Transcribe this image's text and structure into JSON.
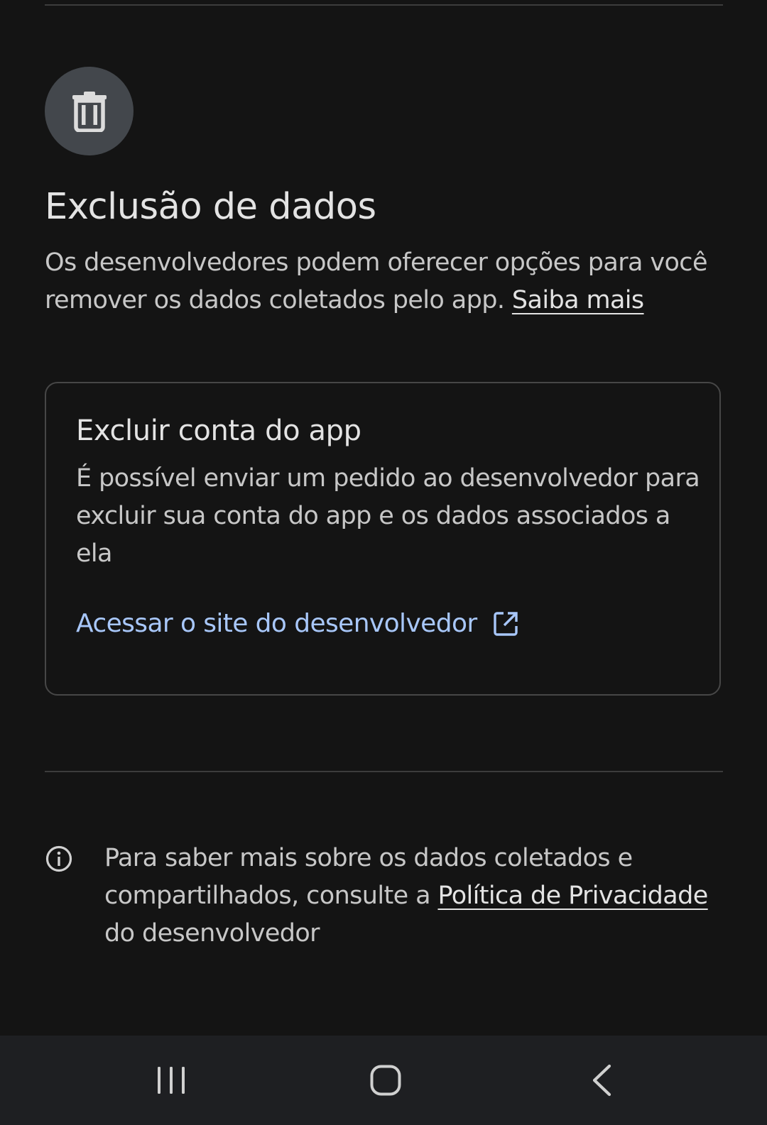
{
  "deletion_section": {
    "title": "Exclusão de dados",
    "description": "Os desenvolvedores podem oferecer opções para você remover os dados coletados pelo app.",
    "learn_more_link": "Saiba mais",
    "icon": "trash-icon"
  },
  "account_card": {
    "title": "Excluir conta do app",
    "description": "É possível enviar um pedido ao desenvolvedor para excluir sua conta do app e os dados associados a ela",
    "link_label": "Acessar o site do desenvolvedor",
    "link_icon": "open-in-new-icon"
  },
  "privacy_info": {
    "icon": "info-icon",
    "text_before": "Para saber mais sobre os dados coletados e compartilhados, consulte a",
    "policy_link": "Política de Privacidade",
    "text_after": "do desenvolvedor"
  },
  "navigation_bar": {
    "recents_icon": "recents-icon",
    "home_icon": "home-icon",
    "back_icon": "back-icon"
  },
  "colors": {
    "background": "#141414",
    "link_blue": "#a8c7fa",
    "icon_circle": "#43474c",
    "nav_background": "#1e1f22"
  }
}
